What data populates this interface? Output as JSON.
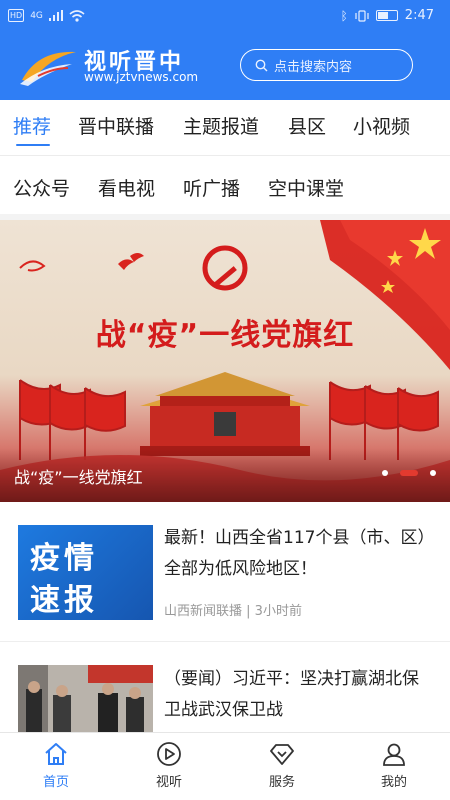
{
  "status_bar": {
    "network_badge": "HD",
    "signal_text": "4G",
    "battery_text": "",
    "time": "2:47"
  },
  "header": {
    "app_name": "视听晋中",
    "url": "www.jztvnews.com",
    "search_placeholder": "点击搜索内容"
  },
  "tabs_primary": [
    {
      "label": "推荐",
      "active": true
    },
    {
      "label": "晋中联播"
    },
    {
      "label": "主题报道"
    },
    {
      "label": "县区"
    },
    {
      "label": "小视频"
    }
  ],
  "tabs_secondary": [
    {
      "label": "公众号"
    },
    {
      "label": "看电视"
    },
    {
      "label": "听广播"
    },
    {
      "label": "空中课堂"
    }
  ],
  "banner": {
    "headline": "战“疫”一线党旗红",
    "caption": "战“疫”一线党旗红",
    "slide_count": 3,
    "active_slide": 2
  },
  "news": [
    {
      "thumb_text_1": "疫情",
      "thumb_text_2": "速报",
      "title": "最新！山西全省117个县（市、区）全部为低风险地区！",
      "source": "山西新闻联播",
      "time": "3小时前"
    },
    {
      "title": "（要闻）习近平：坚决打赢湖北保卫战武汉保卫战"
    }
  ],
  "bottom_nav": [
    {
      "label": "首页",
      "icon": "home-icon",
      "active": true
    },
    {
      "label": "视听",
      "icon": "play-icon"
    },
    {
      "label": "服务",
      "icon": "service-icon"
    },
    {
      "label": "我的",
      "icon": "user-icon"
    }
  ],
  "colors": {
    "brand_blue": "#2f7ef5",
    "accent_red": "#e23a2f"
  }
}
